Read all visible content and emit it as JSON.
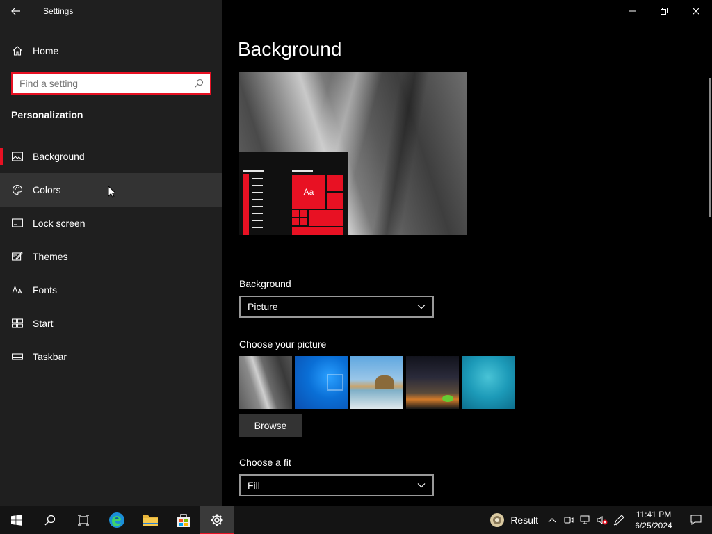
{
  "window": {
    "title": "Settings"
  },
  "sidebar": {
    "home_label": "Home",
    "search_placeholder": "Find a setting",
    "section_title": "Personalization",
    "items": [
      {
        "label": "Background",
        "icon": "picture-icon"
      },
      {
        "label": "Colors",
        "icon": "palette-icon"
      },
      {
        "label": "Lock screen",
        "icon": "lock-screen-icon"
      },
      {
        "label": "Themes",
        "icon": "themes-icon"
      },
      {
        "label": "Fonts",
        "icon": "fonts-icon"
      },
      {
        "label": "Start",
        "icon": "start-icon"
      },
      {
        "label": "Taskbar",
        "icon": "taskbar-icon"
      }
    ],
    "selected_index": 0,
    "hover_index": 1
  },
  "main": {
    "title": "Background",
    "preview_tile_text": "Aa",
    "background_label": "Background",
    "background_value": "Picture",
    "choose_picture_label": "Choose your picture",
    "browse_label": "Browse",
    "fit_label": "Choose a fit",
    "fit_value": "Fill"
  },
  "taskbar": {
    "weather_label": "Result",
    "time": "11:41 PM",
    "date": "6/25/2024"
  },
  "colors": {
    "accent": "#e81123",
    "sidebar_bg": "#1f1f1f",
    "content_bg": "#000000",
    "hover_bg": "#333333"
  }
}
